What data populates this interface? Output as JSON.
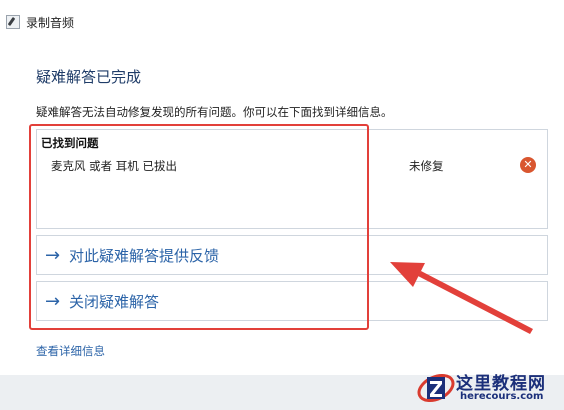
{
  "window": {
    "title": "录制音频"
  },
  "main": {
    "heading": "疑难解答已完成",
    "summary": "疑难解答无法自动修复发现的所有问题。你可以在下面找到详细信息。",
    "problems": {
      "header": "已找到问题",
      "items": [
        {
          "name": "麦克风 或者 耳机 已拔出",
          "status": "未修复"
        }
      ]
    },
    "links": [
      {
        "label": "对此疑难解答提供反馈"
      },
      {
        "label": "关闭疑难解答"
      }
    ],
    "details_link": "查看详细信息"
  },
  "watermark": {
    "title": "这里教程网",
    "url": "herecours.com"
  },
  "colors": {
    "accent": "#2c64a8",
    "heading": "#1f3c68",
    "error": "#d9562f",
    "highlight": "#e2403a"
  },
  "icons": {
    "app": "microphone-pen-icon",
    "status": "error-x-icon",
    "link": "arrow-right-icon"
  }
}
